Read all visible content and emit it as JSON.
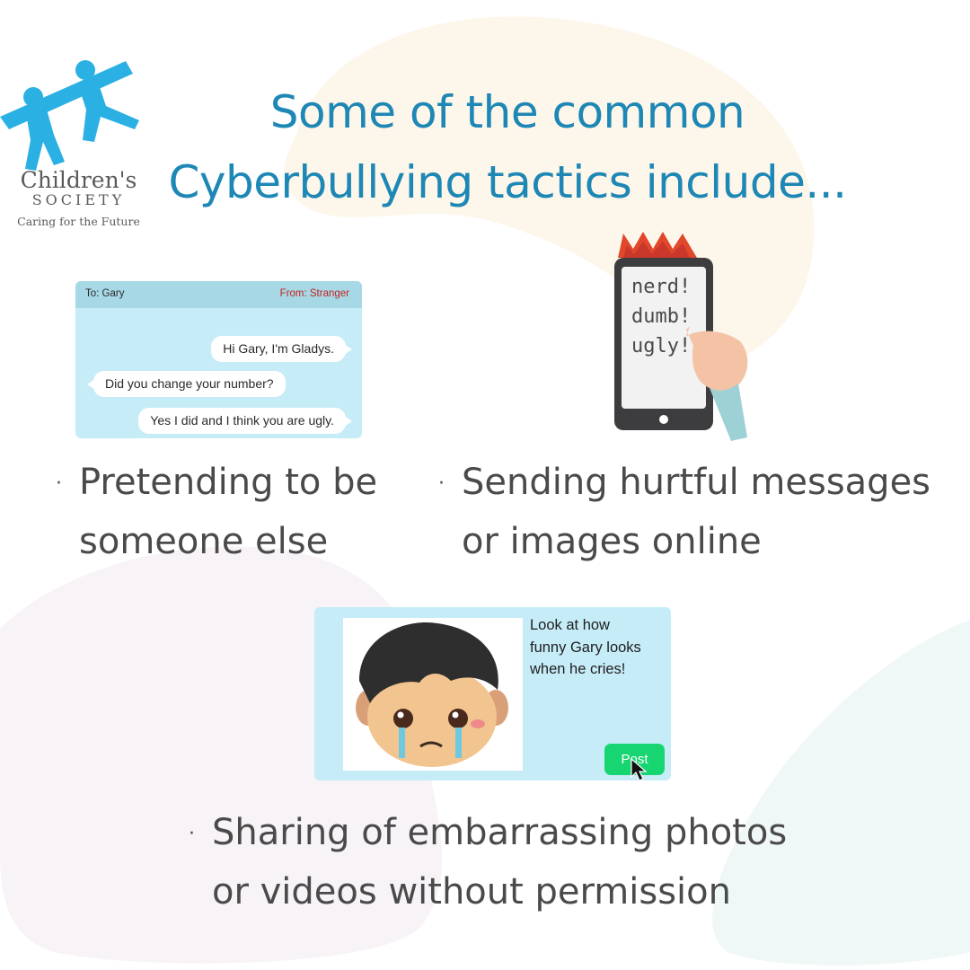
{
  "logo": {
    "name_line1": "Children's",
    "name_line2": "SOCIETY",
    "tagline": "Caring for the Future"
  },
  "title": {
    "line1": "Some of the common",
    "line2": "Cyberbullying tactics include..."
  },
  "chat_card": {
    "to": "To: Gary",
    "from": "From: Stranger",
    "messages": [
      {
        "text": "Hi Gary, I'm Gladys.",
        "side": "right"
      },
      {
        "text": "Did you change your number?",
        "side": "left"
      },
      {
        "text": "Yes I did and I think you are ugly.",
        "side": "right"
      }
    ]
  },
  "phone": {
    "words": [
      "nerd!",
      "dumb!",
      "ugly!"
    ]
  },
  "post_card": {
    "caption_lines": [
      "Look at how",
      "funny Gary looks",
      "when he cries!"
    ],
    "button_label": "Post"
  },
  "tactics": [
    {
      "bullet": "·",
      "line1": "Pretending to be",
      "line2": "someone else"
    },
    {
      "bullet": "·",
      "line1": "Sending hurtful messages",
      "line2": "or images online"
    },
    {
      "bullet": "·",
      "line1": "Sharing of embarrassing photos",
      "line2": "or videos without permission"
    }
  ],
  "colors": {
    "title_blue": "#1d87b5",
    "logo_blue": "#2bb0e3",
    "card_blue": "#c6ecf8",
    "caption_gray": "#4a4a4a",
    "post_green": "#17d672",
    "from_red": "#c0251e"
  }
}
